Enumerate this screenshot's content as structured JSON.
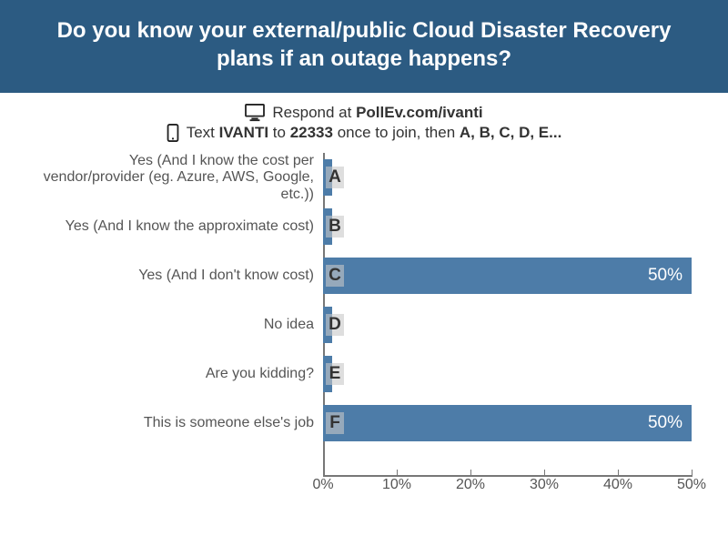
{
  "header": {
    "title": "Do you know your external/public Cloud Disaster Recovery plans if an outage happens?"
  },
  "instructions": {
    "respond_prefix": "Respond at ",
    "respond_url": "PollEv.com/ivanti",
    "text_prefix": "Text ",
    "text_keyword": "IVANTI",
    "text_mid": " to ",
    "text_number": "22333",
    "text_suffix": " once to join, then ",
    "text_options": "A, B, C, D, E..."
  },
  "chart_data": {
    "type": "bar",
    "orientation": "horizontal",
    "xlabel": "",
    "ylabel": "",
    "xlim": [
      0,
      50
    ],
    "ticks": [
      0,
      10,
      20,
      30,
      40,
      50
    ],
    "tick_labels": [
      "0%",
      "10%",
      "20%",
      "30%",
      "40%",
      "50%"
    ],
    "series": [
      {
        "letter": "A",
        "label": "Yes (And I know the cost per vendor/provider (eg. Azure, AWS, Google, etc.))",
        "value": 0,
        "value_label": ""
      },
      {
        "letter": "B",
        "label": "Yes (And I know the approximate cost)",
        "value": 0,
        "value_label": ""
      },
      {
        "letter": "C",
        "label": "Yes (And I don't know cost)",
        "value": 50,
        "value_label": "50%"
      },
      {
        "letter": "D",
        "label": "No idea",
        "value": 0,
        "value_label": ""
      },
      {
        "letter": "E",
        "label": "Are you kidding?",
        "value": 0,
        "value_label": ""
      },
      {
        "letter": "F",
        "label": "This is someone else's job",
        "value": 50,
        "value_label": "50%"
      }
    ],
    "bar_color": "#4d7ca8"
  }
}
